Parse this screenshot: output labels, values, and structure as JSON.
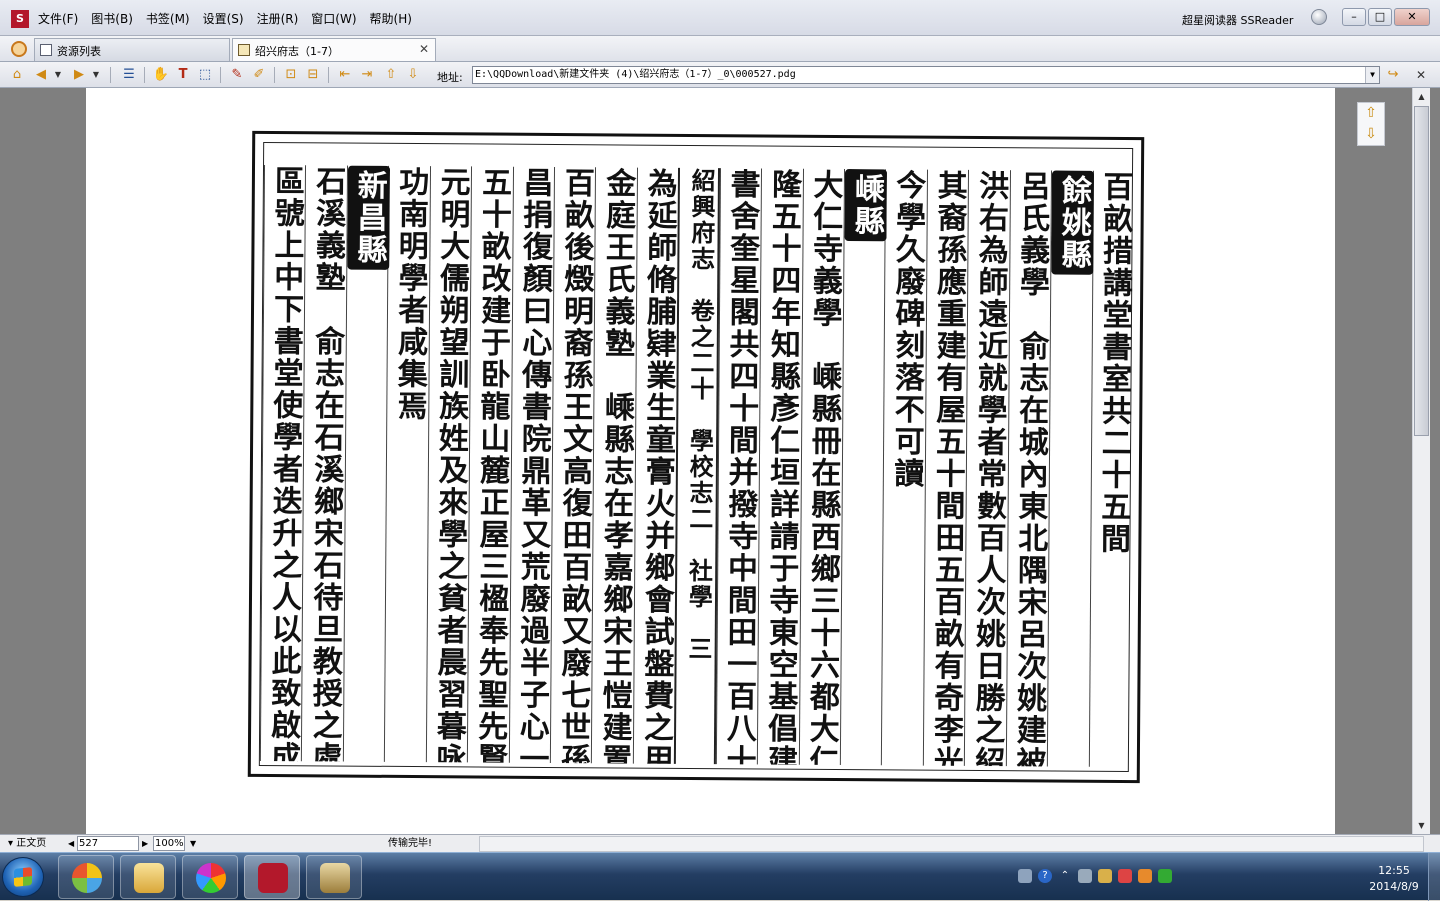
{
  "app": {
    "title": "超星阅读器 SSReader",
    "logo_glyph": "S",
    "menu": [
      "文件(F)",
      "图书(B)",
      "书签(M)",
      "设置(S)",
      "注册(R)",
      "窗口(W)",
      "帮助(H)"
    ]
  },
  "tabs": [
    {
      "label": "资源列表",
      "active": false
    },
    {
      "label": "绍兴府志（1-7）",
      "active": true,
      "close": "✕"
    }
  ],
  "toolbar": {
    "address_label": "地址:",
    "address_value": "E:\\QQDownload\\新建文件夹 (4)\\绍兴府志（1-7）_0\\000527.pdg",
    "dropdown_glyph": "▼"
  },
  "book_page": {
    "columns": [
      "百畝措講堂書室共二十五間",
      "餘姚縣",
      "呂氏義學　俞志在城內東北隅宋呂次姚建被致名儒",
      "洪右為師遠近就學者常數百人次姚日勝之紹興中",
      "其裔孫應重建有屋五十間田五百畝有奇李光有碑",
      "今學久廢碑刻落不可讀",
      "嵊縣",
      "大仁寺義學　嵊縣冊在縣西鄉三十六都大仁寺內乾",
      "隆五十四年知縣彥仁垣詳請于寺東空基倡建講堂",
      "書舍奎星閣共四十間并撥寺中間田一百八十畝以",
      "紹興府志　卷之二十　學校志二　社學　三",
      "為延師脩脯肄業生童膏火并鄉會試盤費之用",
      "金庭王氏義塾　嵊縣志在孝嘉鄉宋王愷建置義田三",
      "百畝後燬明裔孫王文高復田百畝又廢七世孫王應",
      "昌捐復顏曰心傳書院鼎革又荒廢過半子心一捐田",
      "五十畝改建于卧龍山麓正屋三楹奉先聖先賢及宋",
      "元明大儒朔望訓族姓及來學之貧者晨習暮咏朔望課",
      "功南明學者咸集焉",
      "新昌縣",
      "石溪義塾　俞志在石溪鄉宋石待旦教授之處中為三",
      "區號上中下書堂使學者迭升之人以此致啟成名者"
    ]
  },
  "statusbar": {
    "mode_label": "正文页",
    "page_number": "527",
    "zoom": "100%",
    "status_text": "传输完毕!"
  },
  "taskbar": {
    "clock_time": "12:55",
    "clock_date": "2014/8/9"
  },
  "colors": {
    "accent": "#b3182b",
    "taskbar": "#243e63"
  }
}
